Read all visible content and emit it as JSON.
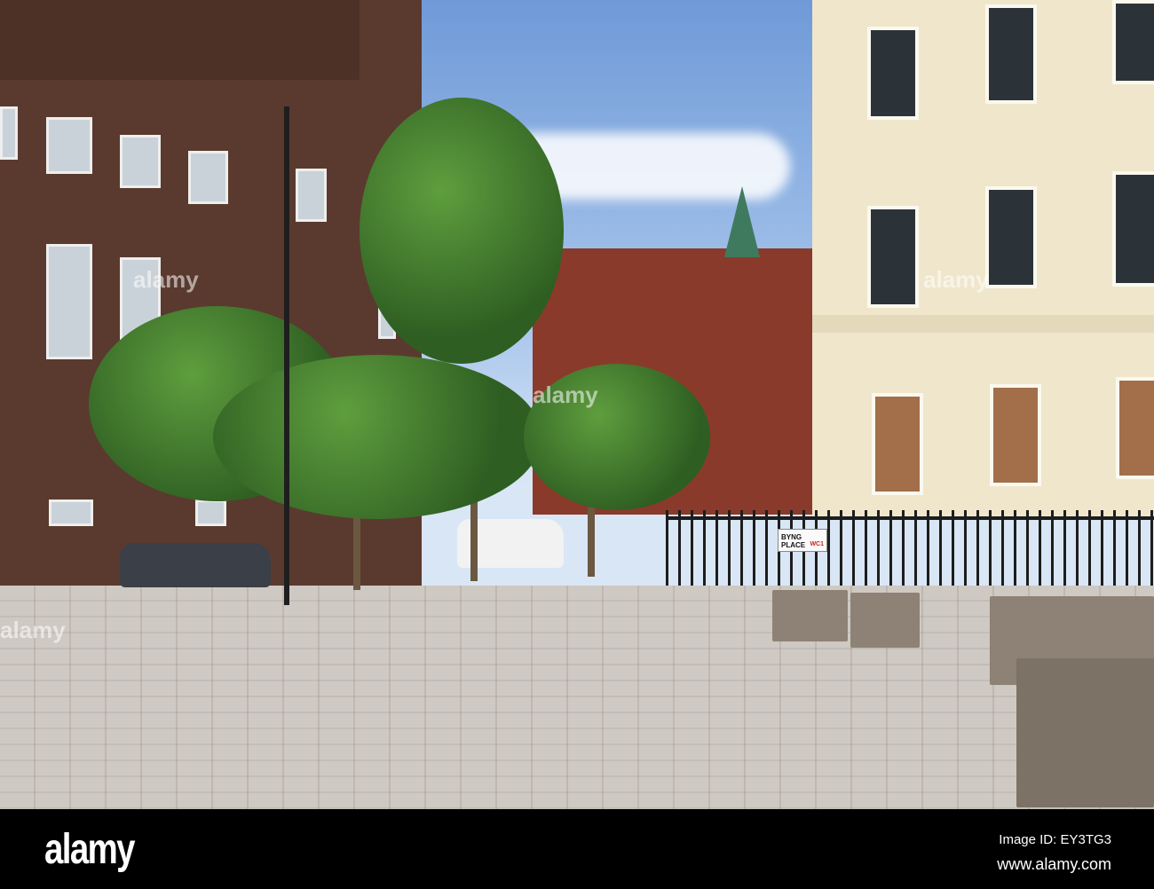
{
  "street_sign": {
    "line1": "BYNG",
    "line2": "PLACE",
    "district": "WC1"
  },
  "watermarks": {
    "text": "alamy"
  },
  "footer": {
    "logo": "alamy",
    "image_id": "Image ID: EY3TG3",
    "url": "www.alamy.com"
  }
}
